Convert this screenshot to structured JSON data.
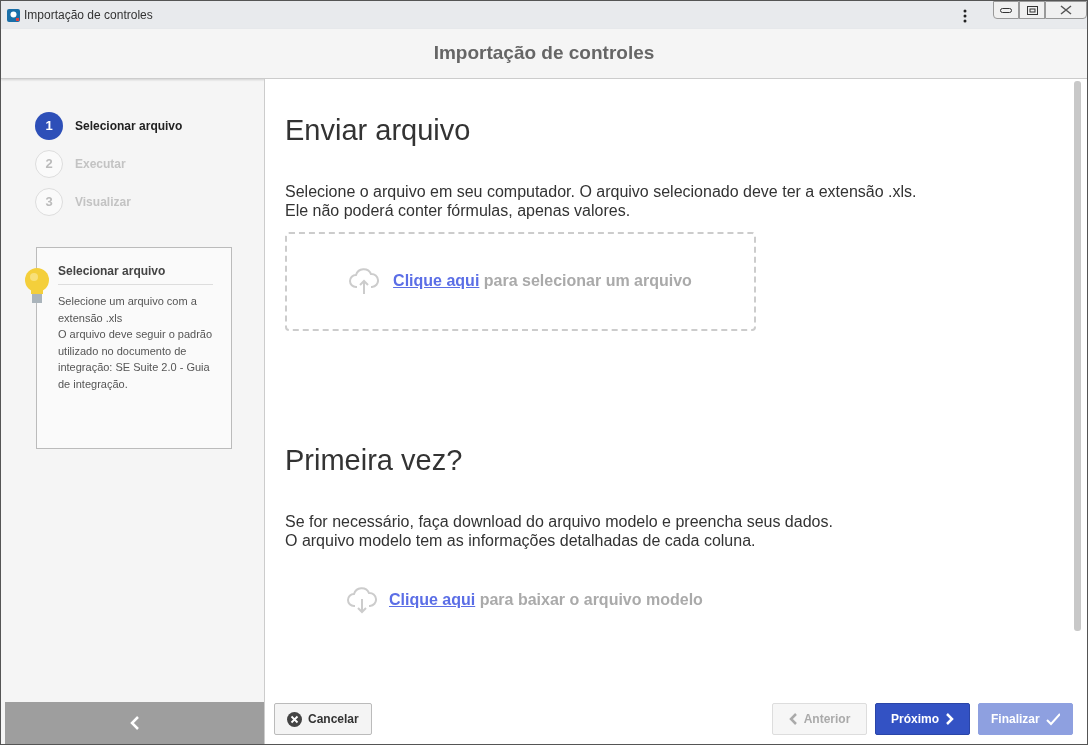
{
  "window": {
    "title": "Importação de controles"
  },
  "header": {
    "title": "Importação de controles"
  },
  "steps": [
    {
      "number": "1",
      "label": "Selecionar arquivo",
      "selected": true
    },
    {
      "number": "2",
      "label": "Executar",
      "selected": false
    },
    {
      "number": "3",
      "label": "Visualizar",
      "selected": false
    }
  ],
  "help_card": {
    "title": "Selecionar arquivo",
    "lines": [
      "Selecione um arquivo com a extensão .xls",
      "O arquivo deve seguir o padrão utilizado no documento de integração: SE Suite 2.0 - Guia de integração."
    ]
  },
  "sections": [
    {
      "kind": "upload",
      "title": "Enviar arquivo",
      "lines": [
        "Selecione o arquivo em seu computador. O arquivo selecionado deve ter a extensão .xls.",
        "Ele não poderá conter fórmulas, apenas valores."
      ],
      "link": "Clique aqui",
      "link_rest": "para selecionar um arquivo"
    },
    {
      "kind": "download",
      "title": "Primeira vez?",
      "lines": [
        "Se for necessário, faça download do arquivo modelo e preencha seus dados.",
        "O arquivo modelo tem as informações detalhadas de cada coluna."
      ],
      "link": "Clique aqui",
      "link_rest": "para baixar o arquivo modelo"
    }
  ],
  "buttons": [
    {
      "kind": "cancel",
      "label": "Cancelar",
      "disabled": false
    },
    {
      "kind": "previous",
      "label": "Anterior",
      "disabled": true
    },
    {
      "kind": "next",
      "label": "Próximo",
      "disabled": false
    },
    {
      "kind": "finish",
      "label": "Finalizar",
      "disabled": true
    }
  ]
}
